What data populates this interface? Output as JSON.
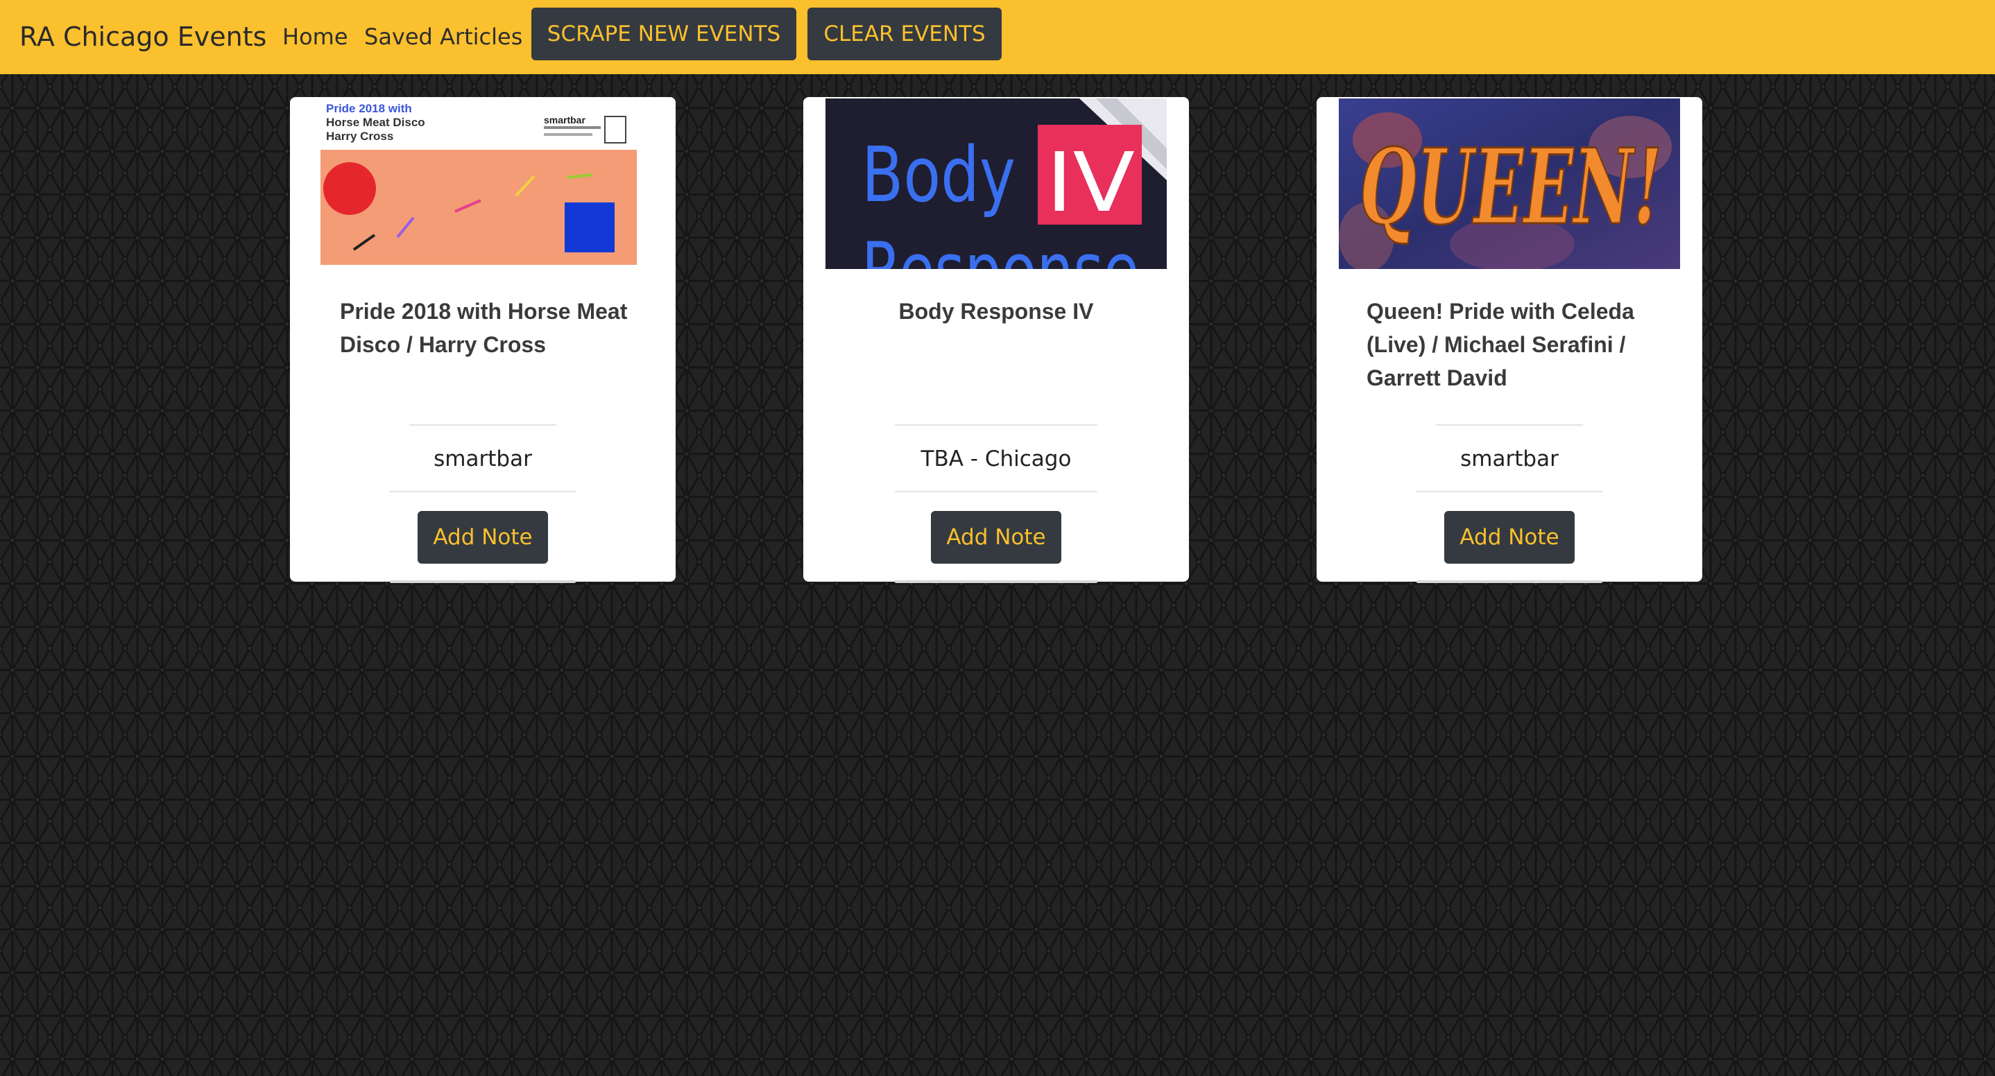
{
  "navbar": {
    "brand": "RA Chicago Events",
    "links": [
      "Home",
      "Saved Articles"
    ],
    "buttons": [
      "SCRAPE NEW EVENTS",
      "CLEAR EVENTS"
    ]
  },
  "colors": {
    "accent": "#fbc02d",
    "button_dark": "#343a40",
    "page_background": "#222222"
  },
  "events": [
    {
      "title": "Pride 2018 with Horse Meat Disco / Harry Cross",
      "venue": "smartbar",
      "add_note_label": "Add Note",
      "flyer": {
        "lines": [
          "Pride 2018 with",
          "Horse Meat Disco",
          "Harry Cross"
        ],
        "venue_mark": "smartbar"
      }
    },
    {
      "title": "Body Response IV",
      "venue": "TBA - Chicago",
      "add_note_label": "Add Note",
      "flyer": {
        "word1": "Body",
        "numeral": "IV",
        "word2": "Response"
      }
    },
    {
      "title": "Queen! Pride with Celeda (Live) / Michael Serafini / Garrett David",
      "venue": "smartbar",
      "add_note_label": "Add Note",
      "flyer": {
        "word": "QUEEN!"
      }
    }
  ]
}
